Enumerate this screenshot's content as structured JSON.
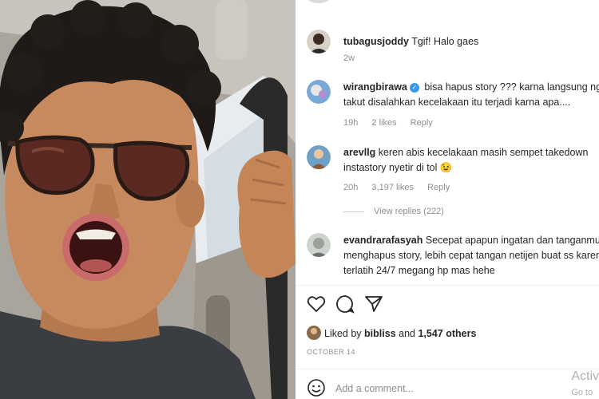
{
  "post": {
    "comments": [
      {
        "username": "tubagusjoddy",
        "text": "Tgif! Halo gaes",
        "time": "2w"
      },
      {
        "username": "wirangbirawa",
        "verified": true,
        "text_line1": "bisa hapus story ??? karna langsung nge",
        "text_line2": "takut disalahkan kecelakaan itu terjadi karna apa....",
        "time": "19h",
        "likes": "2 likes",
        "reply": "Reply"
      },
      {
        "username": "arevllg",
        "text_line1": "keren abis kecelakaan masih sempet takedown",
        "text_line2": "instastory nyetir di tol 😉",
        "time": "20h",
        "likes": "3,197 likes",
        "reply": "Reply"
      },
      {
        "username": "evandrarafasyah",
        "text_line1": "Secepat apapun ingatan dan tanganmu",
        "text_line2": "menghapus story, lebih cepat tangan netijen buat ss karen",
        "text_line3": "terlatih 24/7 megang hp mas hehe"
      }
    ],
    "view_replies": "View replies (222)",
    "likes_by": {
      "prefix": "Liked by",
      "user": "bibliss",
      "joiner": "and",
      "others": "1,547 others"
    },
    "date": "OCTOBER 14",
    "add_comment_placeholder": "Add a comment..."
  },
  "watermark": {
    "line1": "Activ",
    "line2": "Go to"
  },
  "colors": {
    "text": "#262626",
    "muted": "#8e8e8e",
    "verified": "#3897f0"
  },
  "icons": [
    "heart-icon",
    "comment-icon",
    "share-icon",
    "emoji-icon",
    "verified-icon"
  ]
}
